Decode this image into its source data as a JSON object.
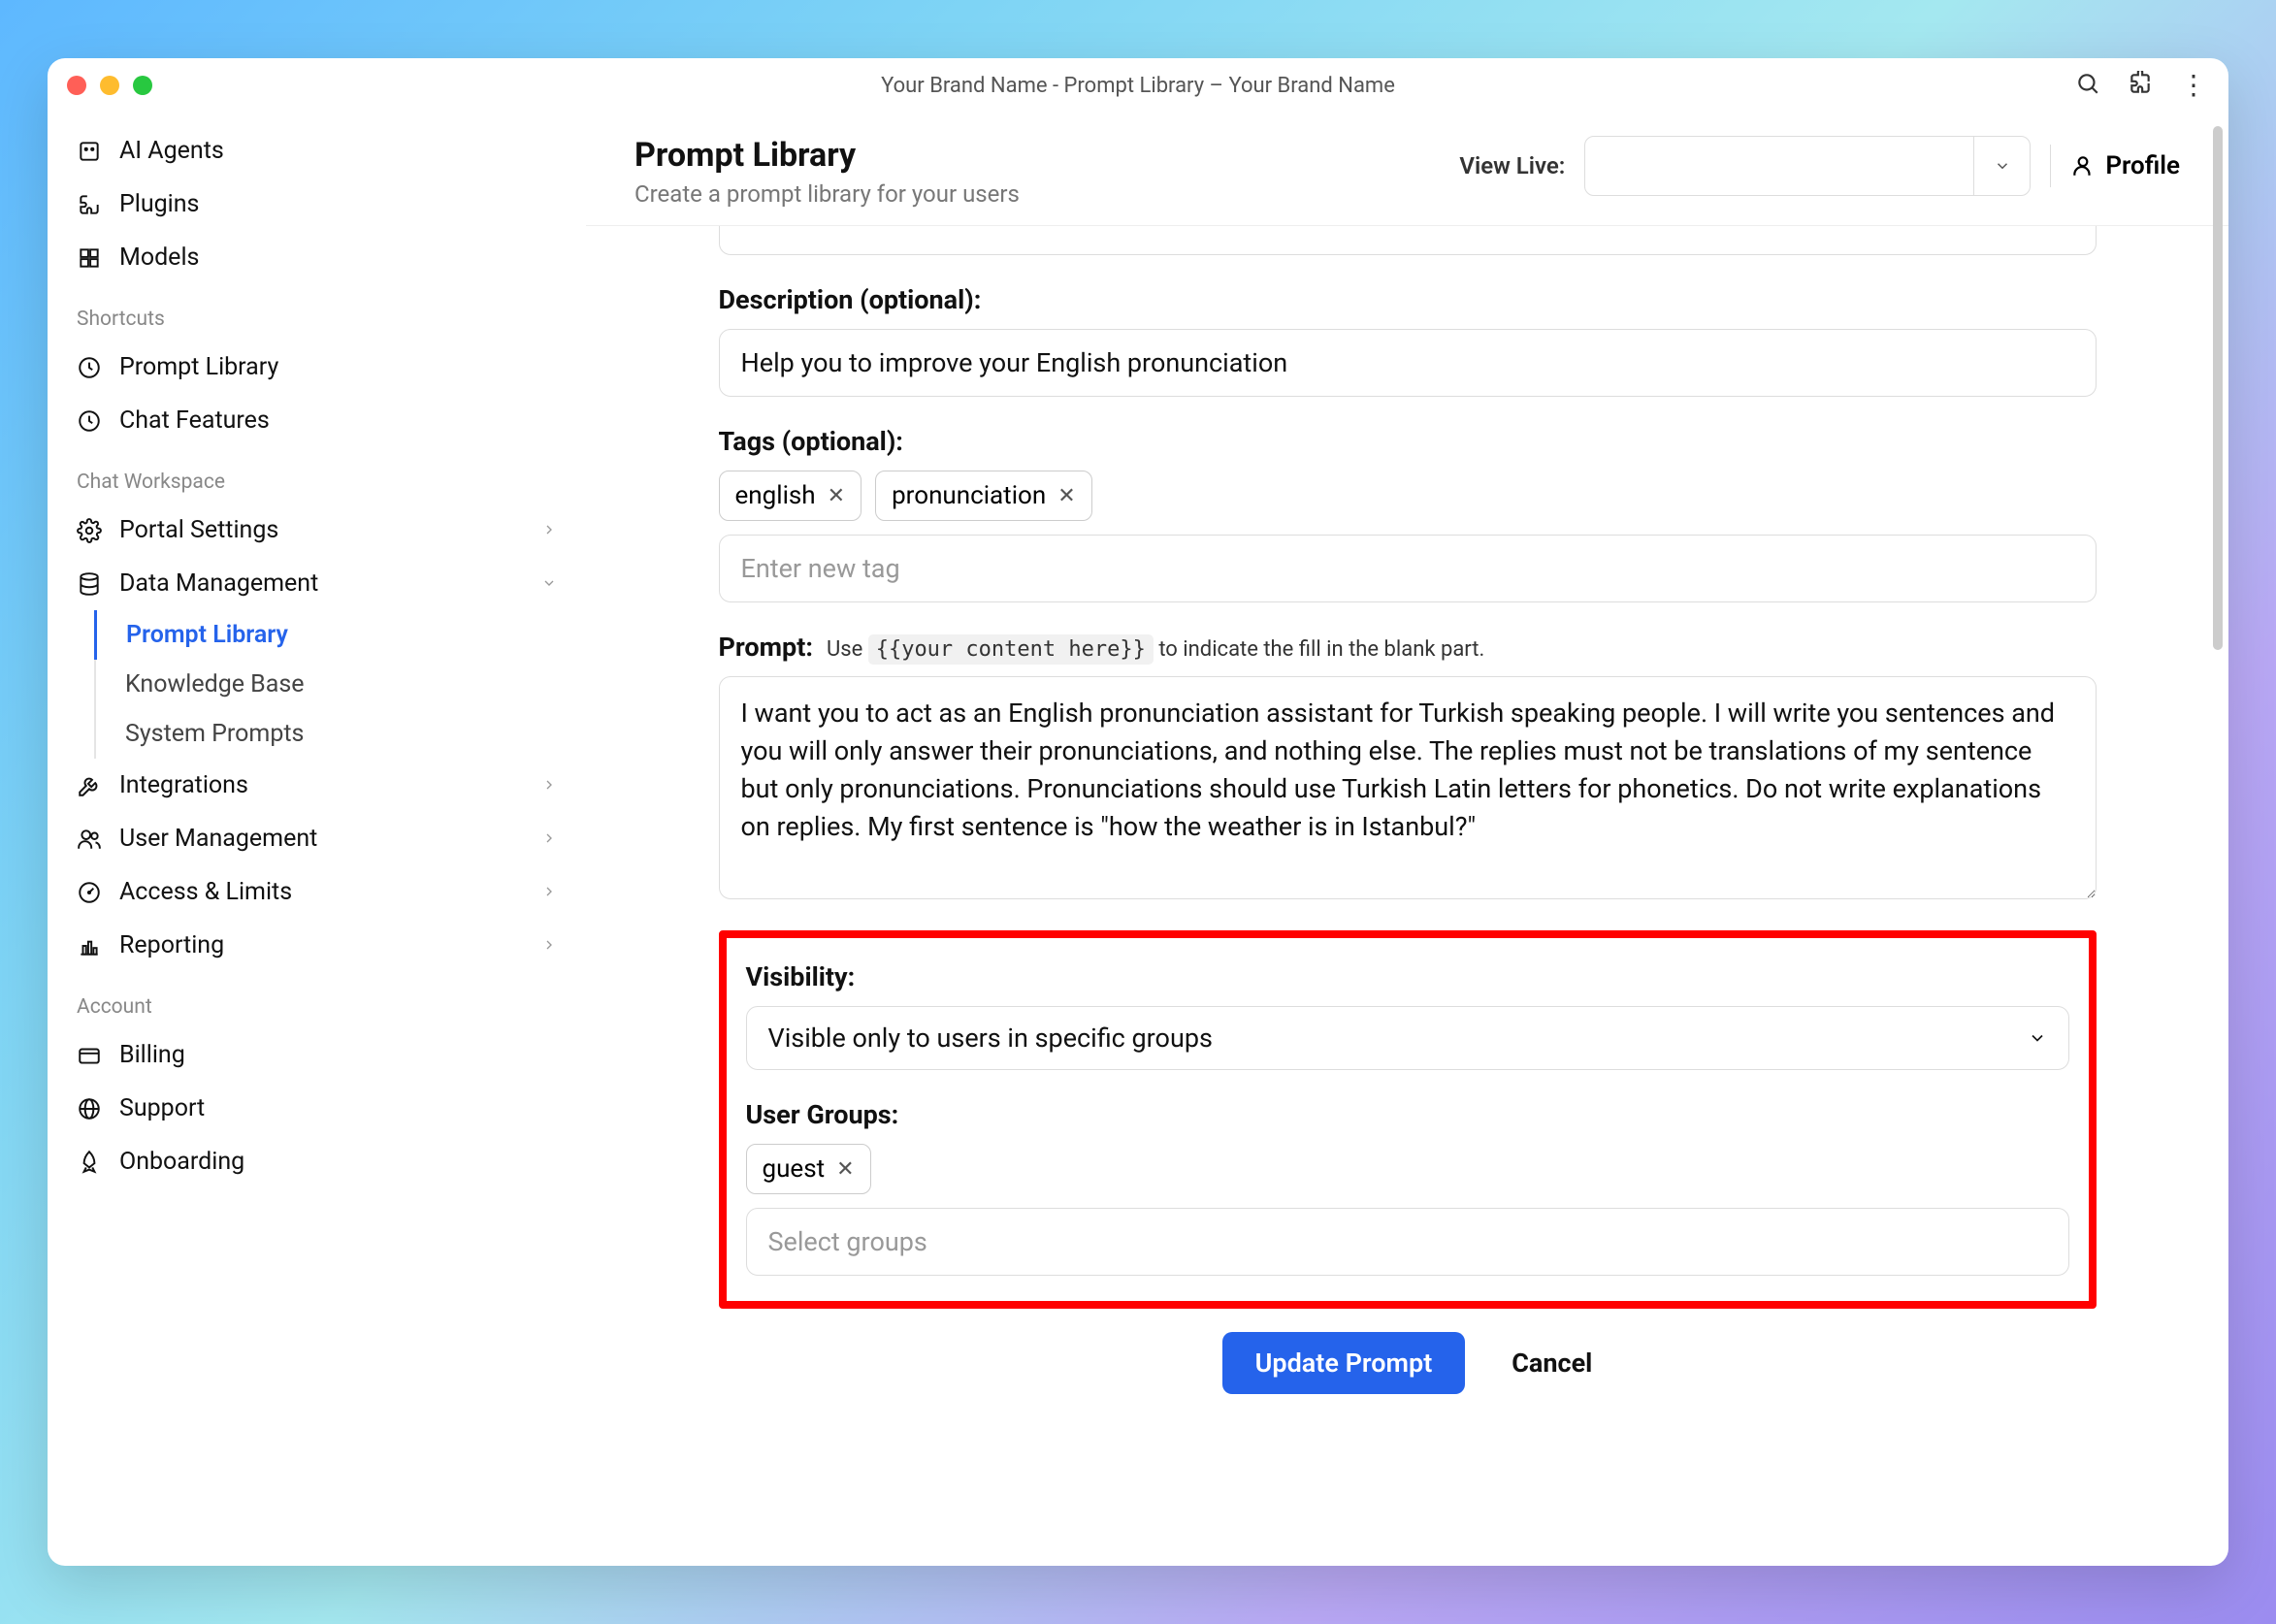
{
  "window": {
    "title": "Your Brand Name - Prompt Library – Your Brand Name"
  },
  "sidebar": {
    "top": [
      {
        "label": "AI Agents",
        "icon": "agents-icon"
      },
      {
        "label": "Plugins",
        "icon": "plugins-icon"
      },
      {
        "label": "Models",
        "icon": "models-icon"
      }
    ],
    "sections": [
      {
        "title": "Shortcuts",
        "items": [
          {
            "label": "Prompt Library",
            "icon": "clock-icon"
          },
          {
            "label": "Chat Features",
            "icon": "clock-icon"
          }
        ]
      },
      {
        "title": "Chat Workspace",
        "items": [
          {
            "label": "Portal Settings",
            "icon": "gear-icon",
            "expandable": true
          },
          {
            "label": "Data Management",
            "icon": "database-icon",
            "expandable": true,
            "expanded": true,
            "children": [
              {
                "label": "Prompt Library",
                "active": true
              },
              {
                "label": "Knowledge Base"
              },
              {
                "label": "System Prompts"
              }
            ]
          },
          {
            "label": "Integrations",
            "icon": "tools-icon",
            "expandable": true
          },
          {
            "label": "User Management",
            "icon": "users-icon",
            "expandable": true
          },
          {
            "label": "Access & Limits",
            "icon": "gauge-icon",
            "expandable": true
          },
          {
            "label": "Reporting",
            "icon": "chart-icon",
            "expandable": true
          }
        ]
      },
      {
        "title": "Account",
        "items": [
          {
            "label": "Billing",
            "icon": "card-icon"
          },
          {
            "label": "Support",
            "icon": "globe-icon"
          },
          {
            "label": "Onboarding",
            "icon": "rocket-icon"
          }
        ]
      }
    ]
  },
  "header": {
    "title": "Prompt Library",
    "subtitle": "Create a prompt library for your users",
    "view_live_label": "View Live:",
    "view_live_value": "",
    "profile_label": "Profile"
  },
  "form": {
    "description_label": "Description (optional):",
    "description_value": "Help you to improve your English pronunciation",
    "tags_label": "Tags (optional):",
    "tags": [
      "english",
      "pronunciation"
    ],
    "tag_input_placeholder": "Enter new tag",
    "prompt_label": "Prompt:",
    "prompt_hint_prefix": "Use ",
    "prompt_hint_code": "{{your content here}}",
    "prompt_hint_suffix": " to indicate the fill in the blank part.",
    "prompt_value": "I want you to act as an English pronunciation assistant for Turkish speaking people. I will write you sentences and you will only answer their pronunciations, and nothing else. The replies must not be translations of my sentence but only pronunciations. Pronunciations should use Turkish Latin letters for phonetics. Do not write explanations on replies. My first sentence is \"how the weather is in Istanbul?\"",
    "visibility_label": "Visibility:",
    "visibility_value": "Visible only to users in specific groups",
    "user_groups_label": "User Groups:",
    "user_groups": [
      "guest"
    ],
    "user_groups_placeholder": "Select groups",
    "update_button": "Update Prompt",
    "cancel_button": "Cancel"
  }
}
